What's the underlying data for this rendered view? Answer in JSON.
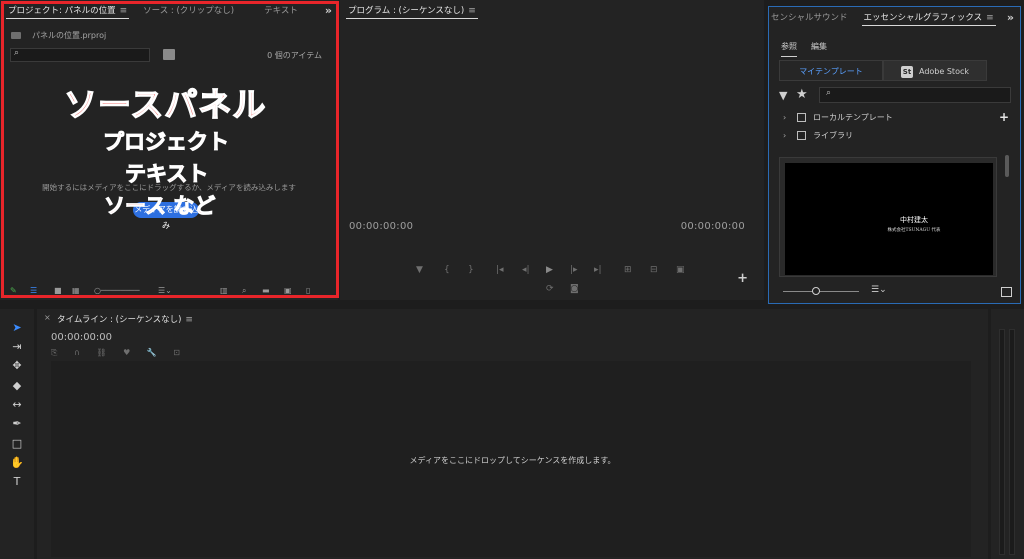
{
  "project_panel": {
    "tabs": [
      {
        "label": "プロジェクト: パネルの位置",
        "active": true
      },
      {
        "label": "ソース : (クリップなし)",
        "active": false
      },
      {
        "label": "テキスト",
        "active": false
      }
    ],
    "file_name": "パネルの位置.prproj",
    "search_icon": "⌕",
    "item_count": "0 個のアイテム",
    "empty_message": "開始するにはメディアをここにドラッグするか、メディアを読み込みします",
    "import_button": "メディアを読み込み",
    "overlay": {
      "title": "ソースパネル",
      "line1": "プロジェクト",
      "line2": "テキスト",
      "line3": "ソース など"
    },
    "frame_color": "#e8252a"
  },
  "program_panel": {
    "tab": "プログラム : (シーケンスなし)",
    "timecode_left": "00:00:00:00",
    "timecode_right": "00:00:00:00",
    "transport_icons": [
      "marker-icon",
      "mark-in-icon",
      "mark-out-icon",
      "go-to-in-icon",
      "step-back-icon",
      "play-icon",
      "step-forward-icon",
      "go-to-out-icon",
      "insert-icon",
      "overwrite-icon",
      "export-frame-icon"
    ]
  },
  "essential_graphics": {
    "tabs": [
      {
        "label": "センシャルサウンド",
        "active": false
      },
      {
        "label": "エッセンシャルグラフィックス",
        "active": true
      }
    ],
    "sub_tabs": [
      "参照",
      "編集"
    ],
    "segments": {
      "my_templates": "マイテンプレート",
      "adobe_stock": "Adobe Stock",
      "stock_badge": "St"
    },
    "search_icon": "⌕",
    "tree": [
      "ローカルテンプレート",
      "ライブラリ"
    ],
    "template": {
      "name": "中村建太",
      "title": "株式会社TSUNAGU 代表"
    },
    "accent_color": "#2a6bb5"
  },
  "tools": [
    "selection-tool",
    "track-select-tool",
    "ripple-edit-tool",
    "razor-tool",
    "slip-tool",
    "pen-tool",
    "rectangle-tool",
    "hand-tool",
    "type-tool"
  ],
  "timeline": {
    "close": "×",
    "tab": "タイムライン : (シーケンスなし)",
    "timecode": "00:00:00:00",
    "drop_message": "メディアをここにドロップしてシーケンスを作成します。"
  }
}
